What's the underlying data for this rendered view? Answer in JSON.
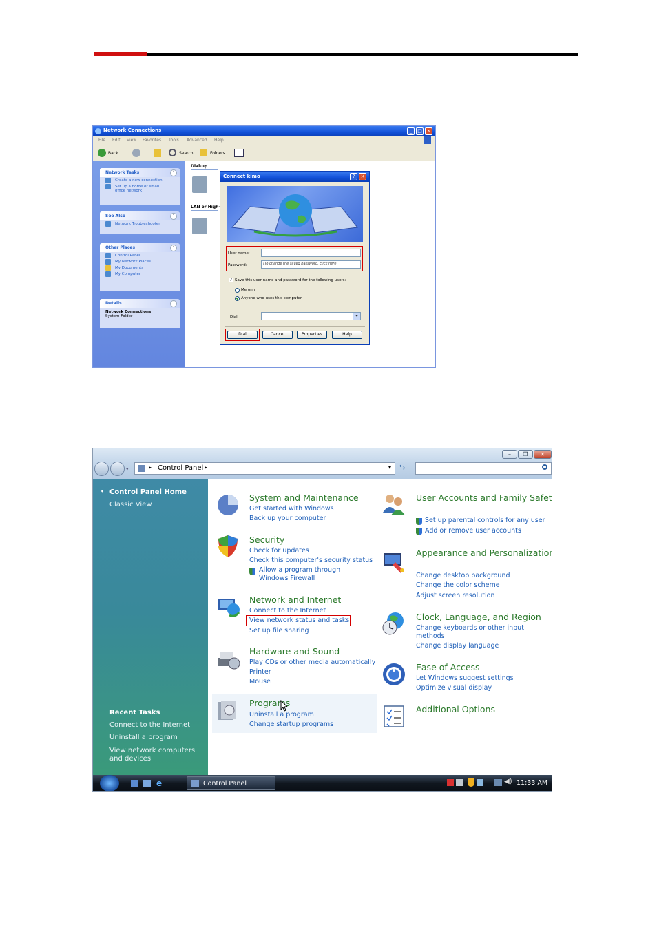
{
  "xp": {
    "title": "Network Connections",
    "menu": [
      "File",
      "Edit",
      "View",
      "Favorites",
      "Tools",
      "Advanced",
      "Help"
    ],
    "toolbar": {
      "back": "Back",
      "search": "Search",
      "folders": "Folders"
    },
    "tasks": {
      "network_tasks": {
        "title": "Network Tasks",
        "items": [
          "Create a new connection",
          "Set up a home or small office network"
        ]
      },
      "see_also": {
        "title": "See Also",
        "items": [
          "Network Troubleshooter"
        ]
      },
      "other_places": {
        "title": "Other Places",
        "items": [
          "Control Panel",
          "My Network Places",
          "My Documents",
          "My Computer"
        ]
      },
      "details": {
        "title": "Details",
        "name": "Network Connections",
        "sub": "System Folder"
      }
    },
    "groups": {
      "dialup": "Dial-up",
      "lan": "LAN or High-"
    },
    "dialog": {
      "title": "Connect kimo",
      "user_label": "User name:",
      "user_value": "",
      "password_label": "Password:",
      "password_value": "[To change the saved password, click here]",
      "save_label": "Save this user name and password for the following users:",
      "me_only": "Me only",
      "anyone": "Anyone who uses this computer",
      "dial_label": "Dial:",
      "buttons": {
        "dial": "Dial",
        "cancel": "Cancel",
        "properties": "Properties",
        "help": "Help"
      }
    }
  },
  "vista": {
    "breadcrumb": "Control Panel",
    "sidebar": {
      "home": "Control Panel Home",
      "classic": "Classic View",
      "recent_title": "Recent Tasks",
      "recent": [
        "Connect to the Internet",
        "Uninstall a program",
        "View network computers and devices"
      ]
    },
    "left_categories": [
      {
        "title": "System and Maintenance",
        "links": [
          "Get started with Windows",
          "Back up your computer"
        ]
      },
      {
        "title": "Security",
        "links": [
          "Check for updates",
          "Check this computer's security status",
          "Allow a program through Windows Firewall"
        ]
      },
      {
        "title": "Network and Internet",
        "links": [
          "Connect to the Internet",
          "View network status and tasks",
          "Set up file sharing"
        ]
      },
      {
        "title": "Hardware and Sound",
        "links": [
          "Play CDs or other media automatically",
          "Printer",
          "Mouse"
        ]
      },
      {
        "title": "Programs",
        "links": [
          "Uninstall a program",
          "Change startup programs"
        ]
      }
    ],
    "right_categories": [
      {
        "title": "User Accounts and Family Safety",
        "links": [
          "Set up parental controls for any user",
          "Add or remove user accounts"
        ]
      },
      {
        "title": "Appearance and Personalization",
        "links": [
          "Change desktop background",
          "Change the color scheme",
          "Adjust screen resolution"
        ]
      },
      {
        "title": "Clock, Language, and Region",
        "links": [
          "Change keyboards or other input methods",
          "Change display language"
        ]
      },
      {
        "title": "Ease of Access",
        "links": [
          "Let Windows suggest settings",
          "Optimize visual display"
        ]
      },
      {
        "title": "Additional Options",
        "links": []
      }
    ],
    "taskbar": {
      "window": "Control Panel",
      "clock": "11:33 AM"
    }
  }
}
